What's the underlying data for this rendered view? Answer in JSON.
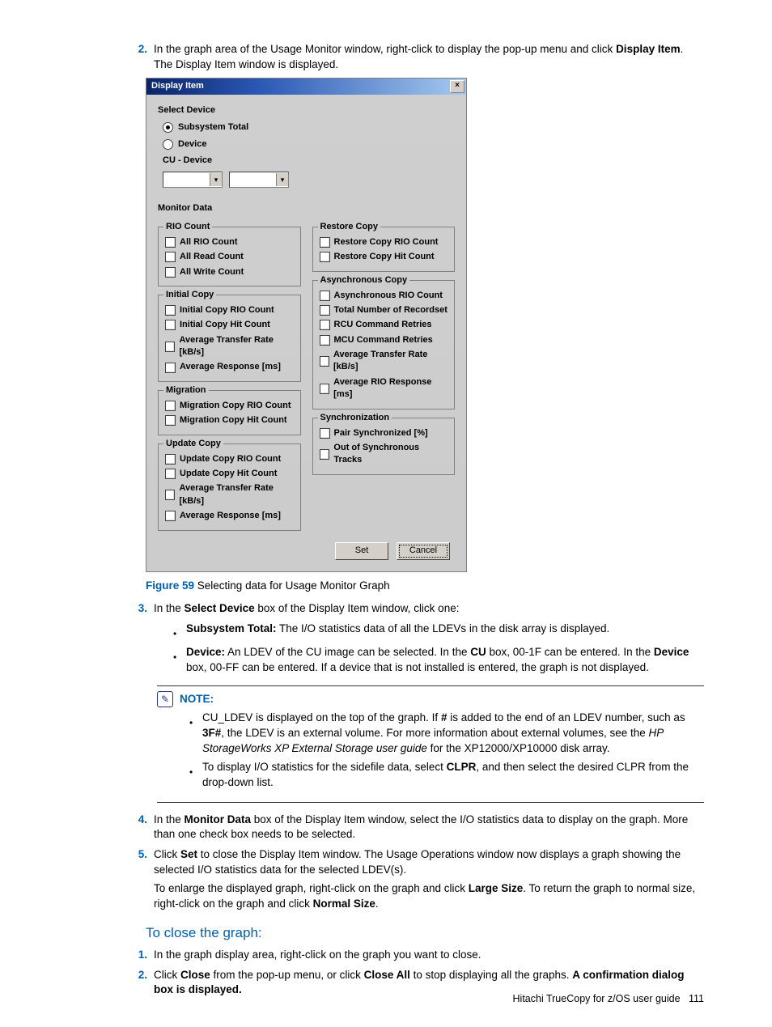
{
  "step2": {
    "num": "2.",
    "text_a": "In the graph area of the Usage Monitor window, right-click to display the pop-up menu and click ",
    "bold": "Display Item",
    "text_b": ". The Display Item window is displayed."
  },
  "dialog": {
    "title": "Display Item",
    "close": "×",
    "select_device_heading": "Select Device",
    "radio_subsystem": "Subsystem Total",
    "radio_device": "Device",
    "cu_device_label": "CU - Device",
    "monitor_data_heading": "Monitor Data",
    "groups_left": [
      {
        "title": "RIO Count",
        "items": [
          "All RIO Count",
          "All Read Count",
          "All Write Count"
        ]
      },
      {
        "title": "Initial Copy",
        "items": [
          "Initial Copy RIO Count",
          "Initial Copy Hit Count",
          "Average Transfer Rate [kB/s]",
          "Average Response [ms]"
        ]
      },
      {
        "title": "Migration",
        "items": [
          "Migration Copy RIO Count",
          "Migration Copy Hit Count"
        ]
      },
      {
        "title": "Update Copy",
        "items": [
          "Update Copy RIO Count",
          "Update Copy Hit Count",
          "Average Transfer Rate [kB/s]",
          "Average Response [ms]"
        ]
      }
    ],
    "groups_right": [
      {
        "title": "Restore Copy",
        "items": [
          "Restore Copy RIO Count",
          "Restore Copy Hit Count"
        ]
      },
      {
        "title": "Asynchronous Copy",
        "items": [
          "Asynchronous RIO Count",
          "Total Number of Recordset",
          "RCU Command Retries",
          "MCU Command Retries",
          "Average Transfer Rate [kB/s]",
          "Average RIO Response [ms]"
        ]
      },
      {
        "title": "Synchronization",
        "items": [
          "Pair Synchronized [%]",
          "Out of Synchronous Tracks"
        ]
      }
    ],
    "set": "Set",
    "cancel": "Cancel"
  },
  "figure": {
    "label": "Figure 59",
    "caption": "  Selecting data for Usage Monitor Graph"
  },
  "step3": {
    "num": "3.",
    "a": "In the ",
    "b": "Select Device",
    "c": " box of the Display Item window, click one:"
  },
  "bullet3a": {
    "b1": "Subsystem Total:",
    "t1": " The I/O statistics data of all the LDEVs in the disk array is displayed."
  },
  "bullet3b": {
    "b1": "Device:",
    "t1": " An LDEV of the CU image can be selected. In the ",
    "b2": "CU",
    "t2": " box, 00-1F can be entered. In the ",
    "b3": "Device",
    "t3": " box, 00-FF can be entered. If a device that is not installed is entered, the graph is not displayed."
  },
  "note": {
    "label": "NOTE:",
    "b1a": "CU_LDEV is displayed on the top of the graph. If ",
    "b1b": "#",
    "b1c": " is added to the end of an LDEV number, such as ",
    "b1d": "3F#",
    "b1e": ", the LDEV is an external volume. For more information about external volumes, see the ",
    "b1f": "HP StorageWorks XP External Storage user guide",
    "b1g": " for the XP12000/XP10000 disk array.",
    "b2a": "To display I/O statistics for the sidefile data, select ",
    "b2b": "CLPR",
    "b2c": ", and then select the desired CLPR from the drop-down list."
  },
  "step4": {
    "num": "4.",
    "a": "In the ",
    "b": "Monitor Data",
    "c": " box of the Display Item window, select the I/O statistics data to display on the graph. More than one check box needs to be selected."
  },
  "step5": {
    "num": "5.",
    "a": "Click ",
    "b": "Set",
    "c": " to close the Display Item window. The Usage Operations window now displays a graph showing the selected I/O statistics data for the selected LDEV(s).",
    "d": "To enlarge the displayed graph, right-click on the graph and click ",
    "e": "Large Size",
    "f": ". To return the graph to normal size, right-click on the graph and click ",
    "g": "Normal Size",
    "h": "."
  },
  "subhead": "To close the graph:",
  "cstep1": {
    "num": "1.",
    "text": "In the graph display area, right-click on the graph you want to close."
  },
  "cstep2": {
    "num": "2.",
    "a": "Click ",
    "b": "Close",
    "c": " from the pop-up menu, or click ",
    "d": "Close All",
    "e": " to stop displaying all the graphs. ",
    "f": "A confirmation dialog box is displayed."
  },
  "footer": {
    "doc": "Hitachi TrueCopy for z/OS user guide",
    "page": "111"
  }
}
